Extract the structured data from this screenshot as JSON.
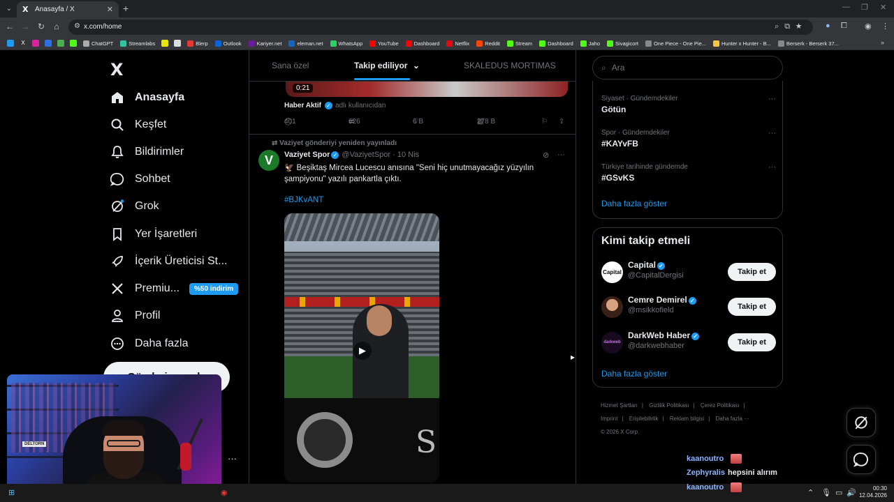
{
  "browser": {
    "tab_title": "Anasayfa / X",
    "tab_favicon": "X",
    "url": "x.com/home",
    "bookmarks": [
      "ChatGPT",
      "Streamlabs",
      "Blerp",
      "Outlook",
      "Kariyer.net",
      "eleman.net",
      "WhatsApp",
      "YouTube",
      "Dashboard",
      "Netflix",
      "Reddit",
      "Stream",
      "Dashboard",
      "Jaho",
      "Sivagicort",
      "One Piece - One Pie...",
      "Hunter x Hunter - B...",
      "Berserk - Berserk 37..."
    ]
  },
  "sidebar": {
    "logo": "X",
    "items": [
      {
        "label": "Anasayfa",
        "icon": "home-icon"
      },
      {
        "label": "Keşfet",
        "icon": "search-icon"
      },
      {
        "label": "Bildirimler",
        "icon": "bell-icon"
      },
      {
        "label": "Sohbet",
        "icon": "chat-icon"
      },
      {
        "label": "Grok",
        "icon": "grok-icon"
      },
      {
        "label": "Yer İşaretleri",
        "icon": "bookmark-icon"
      },
      {
        "label": "İçerik Üreticisi St...",
        "icon": "rocket-icon"
      },
      {
        "label": "Premiu...",
        "icon": "x-premium-icon",
        "badge": "%50 indirim"
      },
      {
        "label": "Profil",
        "icon": "person-icon"
      },
      {
        "label": "Daha fazla",
        "icon": "more-circle-icon"
      }
    ],
    "post_button": "Gönderi yayınla"
  },
  "feed_tabs": [
    {
      "label": "Sana özel"
    },
    {
      "label": "Takip ediliyor"
    },
    {
      "label": "SKALEDUS MORTIMAS"
    }
  ],
  "prev_tweet": {
    "duration": "0:21",
    "source_name": "Haber Aktif",
    "source_suffix": "adlı kullanıcıdan",
    "replies": "401",
    "retweets": "626",
    "likes": "6 B",
    "views": "278 B"
  },
  "tweet": {
    "retweet_note": "Vaziyet gönderiyi yeniden yayınladı",
    "author": "Vaziyet Spor",
    "handle": "@VaziyetSpor",
    "date": "· 10 Nis",
    "text": "Beşiktaş Mircea Lucescu anısına \"Seni hiç unutmayacağız yüzyılın şampiyonu\" yazılı pankartla çıktı.",
    "hashtag": "#BJKvANT"
  },
  "search": {
    "placeholder": "Ara"
  },
  "trends": [
    {
      "category": "Siyaset · Gündemdekiler",
      "tag": "Götün"
    },
    {
      "category": "Spor · Gündemdekiler",
      "tag": "#KAYvFB"
    },
    {
      "category": "Türkiye tarihinde gündemde",
      "tag": "#GSvKS"
    }
  ],
  "trends_show_more": "Daha fazla göster",
  "who_to_follow": {
    "title": "Kimi takip etmeli",
    "accounts": [
      {
        "name": "Capital",
        "handle": "@CapitalDergisi",
        "avatar_text": "Capital",
        "button": "Takip et"
      },
      {
        "name": "Cemre Demirel",
        "handle": "@msikkofield",
        "avatar_text": "",
        "button": "Takip et"
      },
      {
        "name": "DarkWeb Haber",
        "handle": "@darkwebhaber",
        "avatar_text": "darkweb",
        "button": "Takip et"
      }
    ],
    "show_more": "Daha fazla göster"
  },
  "footer": {
    "links": [
      "Hizmet Şartları",
      "Gizlilik Politikası",
      "Çerez Politikası",
      "Imprint",
      "Erişilebilirlik",
      "Reklam bilgisi",
      "Daha fazla ···"
    ],
    "copyright": "© 2026 X Corp."
  },
  "chat_overlay": [
    {
      "user": "kaanoutro",
      "message": ""
    },
    {
      "user": "Zephyralis",
      "message": "hepsini alırım"
    },
    {
      "user": "kaanoutro",
      "message": ""
    }
  ],
  "overlay": {
    "webcam_sign": "DELTORN"
  },
  "taskbar": {
    "time": "00:30",
    "date": "12.04.2026"
  },
  "colors": {
    "accent": "#1d9bf0",
    "background": "#000000",
    "border": "#2f3336",
    "text": "#e7e9ea",
    "muted": "#71767b"
  }
}
